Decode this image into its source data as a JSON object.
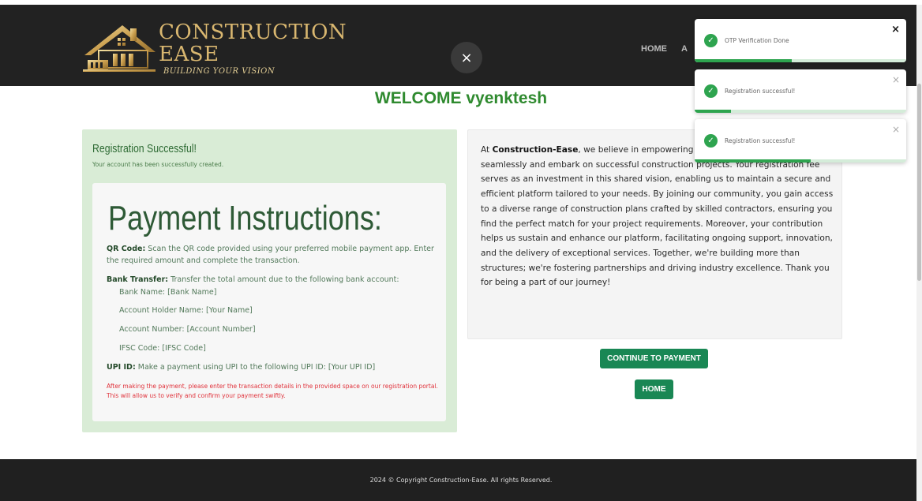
{
  "brand": {
    "title": "CONSTRUCTION EASE",
    "tagline": "BUILDING YOUR VISION",
    "gold": "#d9b770"
  },
  "nav": {
    "close_glyph": "×",
    "links": [
      "HOME",
      "A"
    ]
  },
  "welcome": "WELCOME vyenktesh",
  "registration": {
    "title": "Registration Successful!",
    "subtitle": "Your account has been successfully created."
  },
  "instructions": {
    "title": "Payment Instructions:",
    "qr_label": "QR Code:",
    "qr_text": "Scan the QR code provided using your preferred mobile payment app. Enter the required amount and complete the transaction.",
    "bank_label": "Bank Transfer:",
    "bank_text": "Transfer the total amount due to the following bank account:",
    "bank_name": "Bank Name: [Bank Name]",
    "holder": "Account Holder Name: [Your Name]",
    "number": "Account Number: [Account Number]",
    "ifsc": "IFSC Code: [IFSC Code]",
    "upi_label": "UPI ID:",
    "upi_text": "Make a payment using UPI to the following UPI ID: [Your UPI ID]",
    "warning": "After making the payment, please enter the transaction details in the provided space on our registration portal. This will allow us to verify and confirm your payment swiftly."
  },
  "about": {
    "lead": "At ",
    "brand": "Construction-Ease",
    "text": ", we believe in empowering builders and clients to connect seamlessly and embark on successful construction projects. Your registration fee serves as an investment in this shared vision, enabling us to maintain a secure and efficient platform tailored to your needs. By joining our community, you gain access to a diverse range of construction plans crafted by skilled contractors, ensuring you find the perfect match for your project requirements. Moreover, your contribution helps us sustain and enhance our platform, facilitating ongoing support, innovation, and the delivery of exceptional services. Together, we're building more than structures; we're fostering partnerships and driving industry excellence. Thank you for being a part of our journey!"
  },
  "buttons": {
    "continue": "CONTINUE TO PAYMENT",
    "home": "HOME"
  },
  "footer": "2024 © Copyright Construction-Ease. All rights Reserved.",
  "toasts": [
    {
      "message": "OTP Verification Done",
      "close": "×",
      "progress": 0.46,
      "icon": "check-circle-icon"
    },
    {
      "message": "Registration successful!",
      "close": "×",
      "progress": 0.17,
      "icon": "check-circle-icon"
    },
    {
      "message": "Registration successful!",
      "close": "×",
      "progress": 0.55,
      "icon": "check-circle-icon"
    }
  ],
  "colors": {
    "accent_green": "#198754",
    "success_green": "#2ea44f",
    "welcome_green": "#2f8a2f",
    "card_green": "#d9ecd6",
    "warning_red": "#e0323b"
  }
}
